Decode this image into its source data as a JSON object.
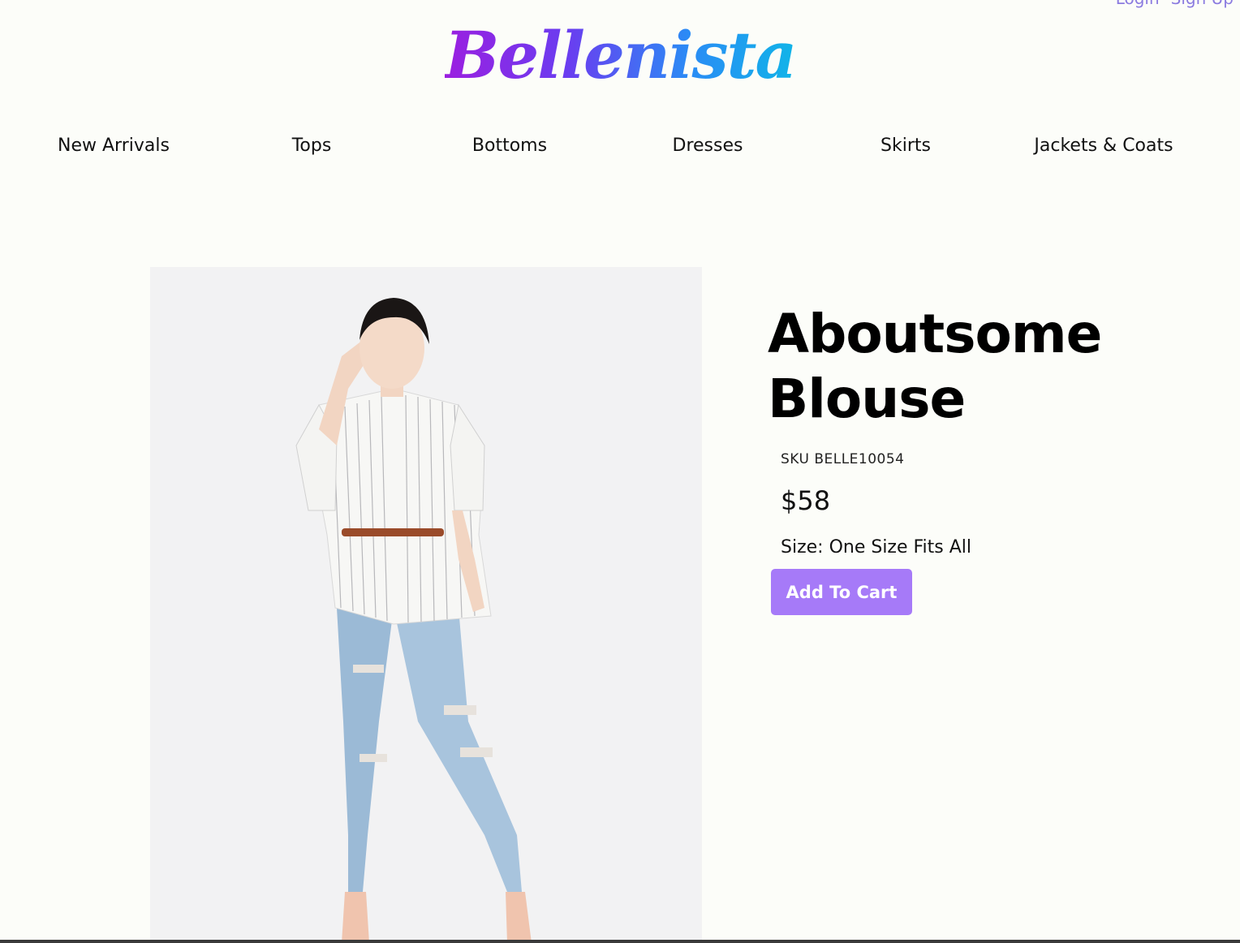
{
  "header": {
    "brand": "Bellenista",
    "auth": {
      "login": "Login",
      "signup": "Sign Up"
    }
  },
  "nav": {
    "items": [
      {
        "label": "New Arrivals"
      },
      {
        "label": "Tops"
      },
      {
        "label": "Bottoms"
      },
      {
        "label": "Dresses"
      },
      {
        "label": "Skirts"
      },
      {
        "label": "Jackets & Coats"
      }
    ]
  },
  "product": {
    "title_line1": "Aboutsome",
    "title_line2": "Blouse",
    "sku": "SKU BELLE10054",
    "price": "$58",
    "size": "Size: One Size Fits All",
    "add_to_cart": "Add To Cart",
    "image_alt": "Aboutsome Blouse"
  },
  "colors": {
    "background": "#fcfdf9",
    "button": "#a67af8",
    "auth_link": "#8b7be0",
    "logo_gradient_start": "#9b1fe0",
    "logo_gradient_end": "#11b4e8"
  }
}
